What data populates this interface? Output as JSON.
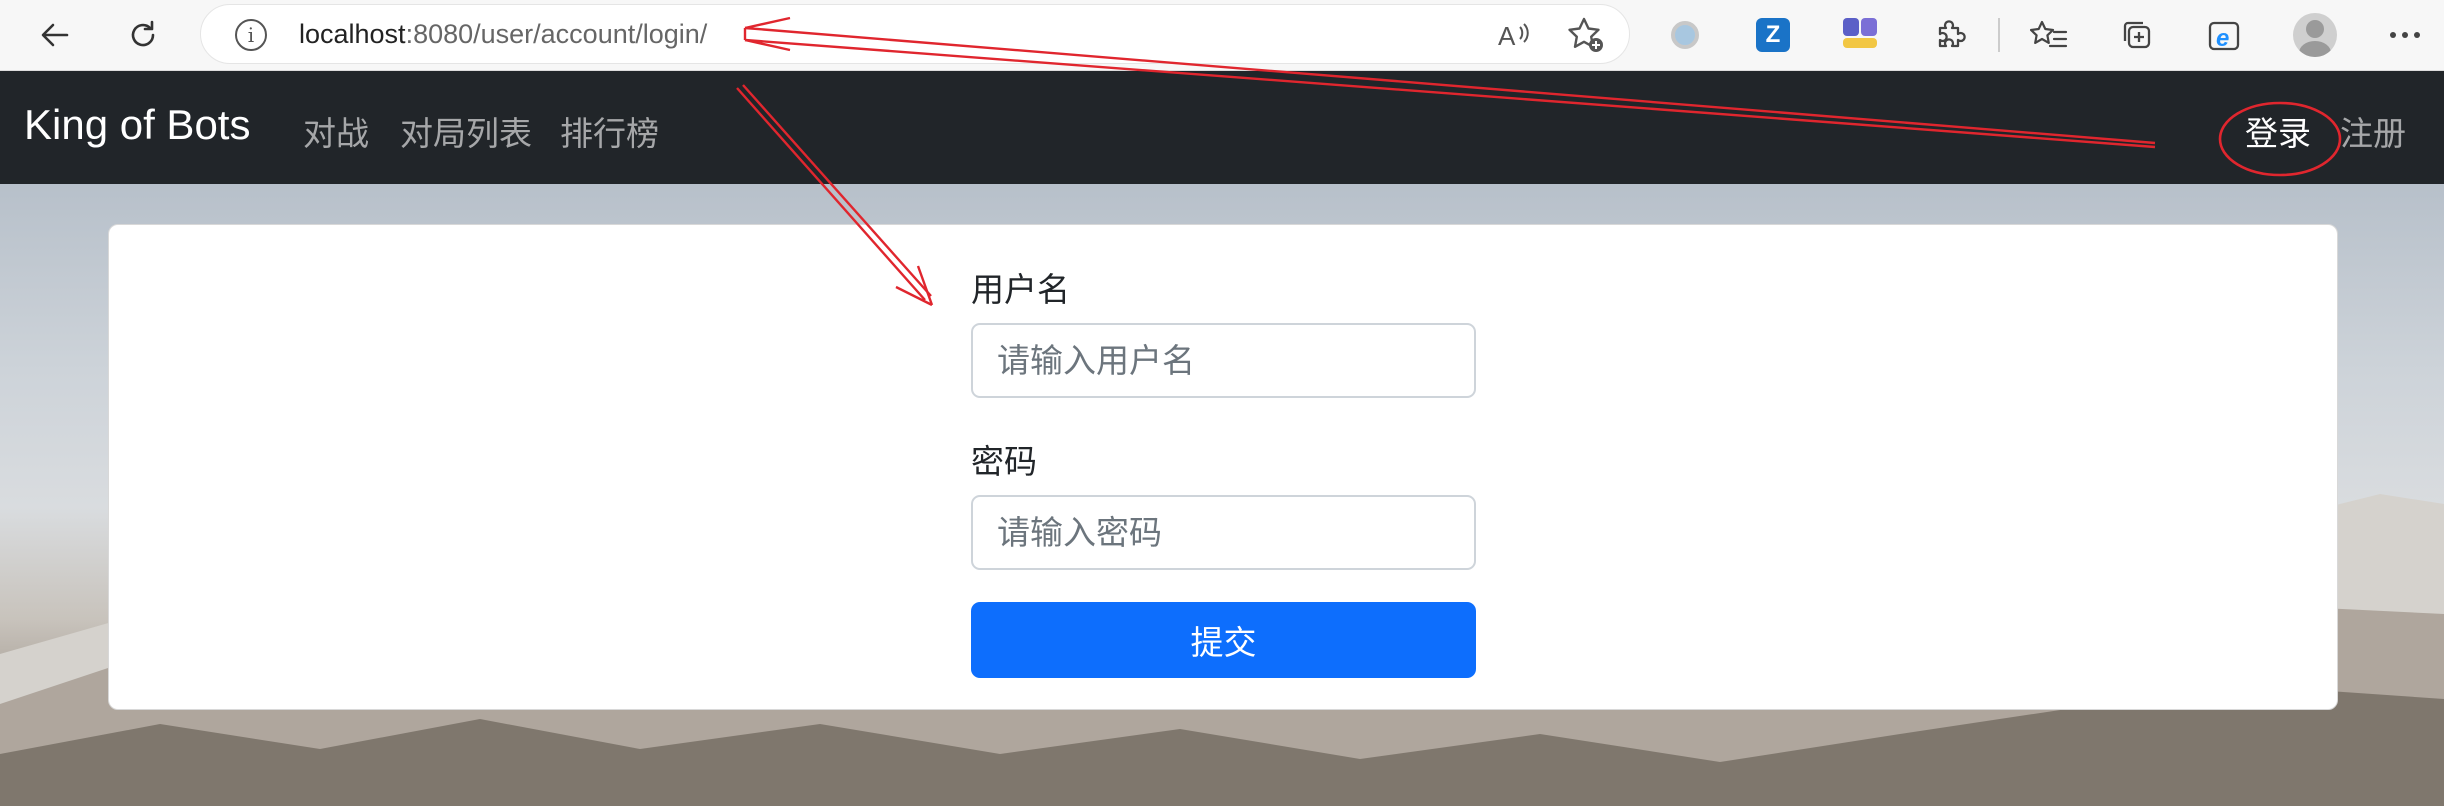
{
  "browser": {
    "back_icon": "arrow-left-icon",
    "refresh_icon": "refresh-icon",
    "url_host": "localhost",
    "url_rest": ":8080/user/account/login/",
    "read_aloud_label": "Ȃ",
    "icons": [
      "site-info-icon",
      "read-aloud-icon",
      "add-favorite-icon",
      "extension-circle-icon",
      "extension-z-icon",
      "extension-purple-icon",
      "extensions-puzzle-icon",
      "favorites-icon",
      "collections-icon",
      "ie-mode-icon",
      "profile-avatar-icon",
      "more-menu-icon"
    ]
  },
  "navbar": {
    "brand": "King of Bots",
    "links": [
      "对战",
      "对局列表",
      "排行榜"
    ],
    "login": "登录",
    "register": "注册"
  },
  "form": {
    "username_label": "用户名",
    "username_placeholder": "请输入用户名",
    "password_label": "密码",
    "password_placeholder": "请输入密码",
    "submit_label": "提交"
  },
  "colors": {
    "navbar_bg": "#212529",
    "primary": "#0d6efd",
    "annotation": "#e0262e"
  }
}
